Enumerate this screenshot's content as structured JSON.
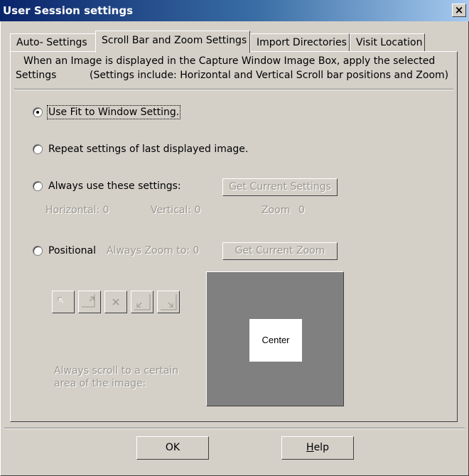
{
  "window": {
    "title": "User Session settings",
    "close_label": "×"
  },
  "tabs": [
    {
      "label": "Auto- Settings"
    },
    {
      "label": "Scroll Bar and Zoom Settings"
    },
    {
      "label": "Import Directories"
    },
    {
      "label": "Visit Location"
    }
  ],
  "description": {
    "line1": "When an Image is displayed in the Capture Window Image Box, apply the selected",
    "line2_left": "Settings",
    "line2_right": "(Settings include: Horizontal and Vertical Scroll bar positions and Zoom)"
  },
  "options": {
    "fit_to_window": {
      "label": "Use Fit to Window Setting.",
      "checked": true
    },
    "repeat_last": {
      "label": "Repeat settings of last displayed image.",
      "checked": false
    },
    "always_use": {
      "label": "Always use these settings:",
      "checked": false
    },
    "positional": {
      "label": "Positional",
      "checked": false
    }
  },
  "always_use": {
    "button": "Get Current Settings",
    "horizontal": "Horizontal: 0",
    "vertical": "Vertical: 0",
    "zoom_label": "Zoom",
    "zoom_value": "0"
  },
  "positional": {
    "zoom_text": "Always Zoom to: 0",
    "button": "Get Current Zoom",
    "hint_line1": "Always scroll to a certain",
    "hint_line2": "area of the image:",
    "preview_label": "Center"
  },
  "footer": {
    "ok": "OK",
    "help_mnemonic": "H",
    "help_rest": "elp"
  },
  "colors": {
    "title_start": "#0a246a",
    "title_end": "#a6caf0",
    "face": "#d4d0c8",
    "disabled_text": "#9a978f",
    "preview_bg": "#808080"
  }
}
